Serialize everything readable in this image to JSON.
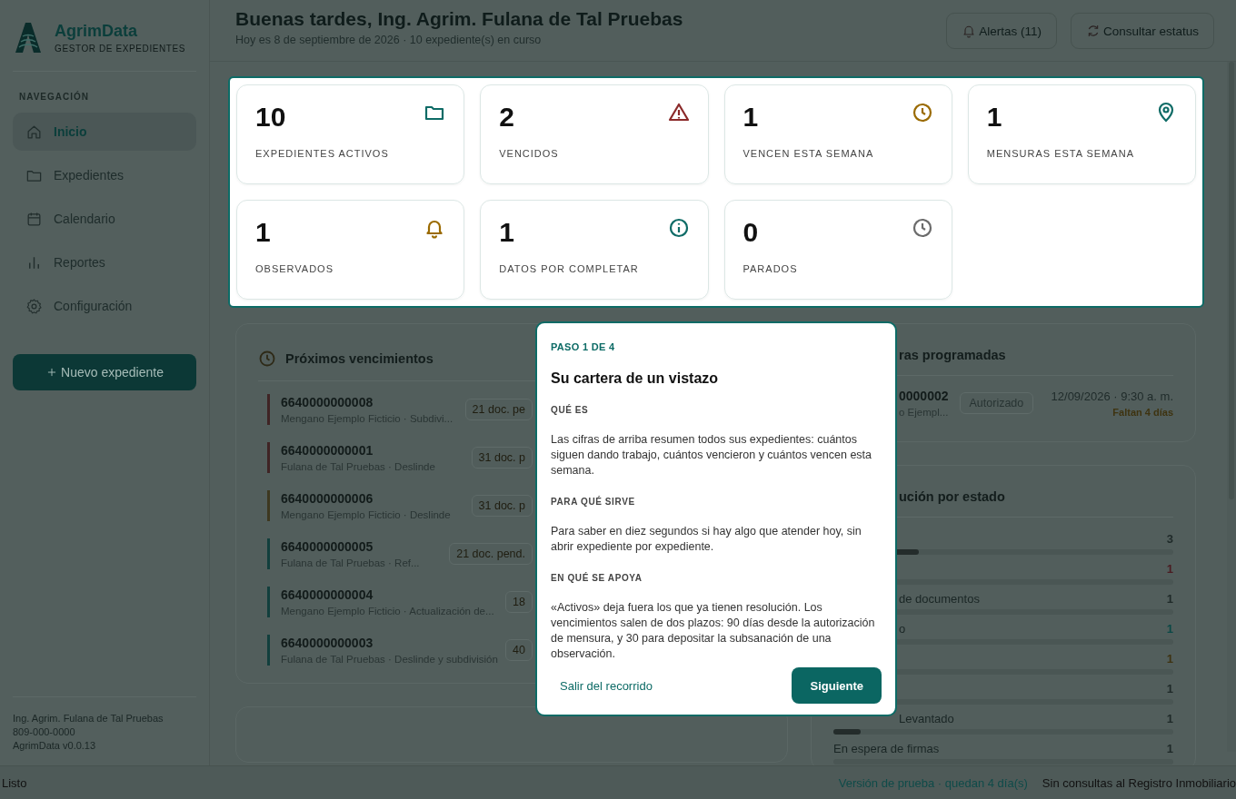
{
  "sidebar": {
    "brand": {
      "name": "AgrimData",
      "tagline": "GESTOR DE EXPEDIENTES"
    },
    "section_label": "NAVEGACIÓN",
    "items": [
      {
        "label": "Inicio",
        "kind": "home",
        "selected": true
      },
      {
        "label": "Expedientes",
        "kind": "folder",
        "selected": false
      },
      {
        "label": "Calendario",
        "kind": "calendar",
        "selected": false
      },
      {
        "label": "Reportes",
        "kind": "bars",
        "selected": false
      },
      {
        "label": "Configuración",
        "kind": "gear",
        "selected": false
      }
    ],
    "new_button": "Nuevo expediente",
    "footer": [
      "Ing. Agrim. Fulana de Tal Pruebas",
      "809-000-0000",
      "AgrimData v0.0.13"
    ]
  },
  "header": {
    "title": "Buenas tardes, Ing. Agrim. Fulana de Tal Pruebas",
    "subtitle": "Hoy es 8 de septiembre de 2026 · 10 expediente(s) en curso",
    "buttons": [
      {
        "label": "Alertas (11)",
        "kind": "bell"
      },
      {
        "label": "Consultar estatus",
        "kind": "refresh"
      }
    ]
  },
  "stats": [
    {
      "value": "10",
      "label": "EXPEDIENTES ACTIVOS",
      "kind": "folder",
      "color": "#0e6b66"
    },
    {
      "value": "2",
      "label": "VENCIDOS",
      "kind": "warning",
      "color": "#8b2a2a"
    },
    {
      "value": "1",
      "label": "VENCEN ESTA SEMANA",
      "kind": "clock",
      "color": "#9a6a00"
    },
    {
      "value": "1",
      "label": "MENSURAS ESTA SEMANA",
      "kind": "pin",
      "color": "#0e6b66"
    },
    {
      "value": "1",
      "label": "OBSERVADOS",
      "kind": "bell",
      "color": "#9a6a00"
    },
    {
      "value": "1",
      "label": "DATOS POR COMPLETAR",
      "kind": "info",
      "color": "#0e6b66"
    },
    {
      "value": "0",
      "label": "PARADOS",
      "kind": "clock",
      "color": "#6b6b6b"
    }
  ],
  "deadlines": {
    "title": "Próximos vencimientos",
    "rows": [
      {
        "id": "6640000000008",
        "detail": "Mengano Ejemplo Ficticio · Subdivi...",
        "badges": [
          "21 doc. pe"
        ],
        "color": "#3f2424"
      },
      {
        "id": "6640000000001",
        "detail": "Fulana de Tal Pruebas · Deslinde",
        "badges": [
          "31 doc. p"
        ],
        "color": "#3f2424"
      },
      {
        "id": "6640000000006",
        "detail": "Mengano Ejemplo Ficticio · Deslinde",
        "badges": [
          "31 doc. p"
        ],
        "color": "#3e3820"
      },
      {
        "id": "6640000000005",
        "detail": "Fulana de Tal Pruebas · Ref...",
        "badges": [
          "21 doc. pend."
        ],
        "color": "#123f3d"
      },
      {
        "id": "6640000000004",
        "detail": "Mengano Ejemplo Ficticio · Actualización de...",
        "badges": [
          "18"
        ],
        "color": "#123f3d"
      },
      {
        "id": "6640000000003",
        "detail": "Fulana de Tal Pruebas · Deslinde y subdivisión",
        "badges": [
          "40"
        ],
        "color": "#123f3d"
      }
    ]
  },
  "surveys": {
    "title": "ras programadas",
    "rows": [
      {
        "id": "0000002",
        "detail": "o Ejempl...",
        "badge": "Autorizado",
        "date": "12/09/2026 · 9:30 a. m.",
        "remaining": "Faltan 4 días"
      }
    ]
  },
  "distribution": {
    "title": "ución por estado",
    "rows": [
      {
        "count": "3",
        "level": 0.25,
        "color": "#1f2a29"
      },
      {
        "count": "1",
        "color": "#4a1c22"
      },
      {
        "label": "de documentos",
        "count": "1",
        "color": "#1f2a29"
      },
      {
        "label": "o",
        "count": "1",
        "color": "#0b4846"
      },
      {
        "count": "1",
        "color": "#3e3312"
      },
      {
        "count": "1",
        "color": "#1f2a29"
      },
      {
        "label": "Levantado",
        "count": "1",
        "level": 0.08,
        "color": "#1f2a29"
      },
      {
        "label": "En espera de firmas",
        "count": "1",
        "color": "#1f2a29"
      }
    ]
  },
  "tour": {
    "step": "PASO 1 DE 4",
    "title": "Su cartera de un vistazo",
    "sections": [
      {
        "heading": "QUÉ ES",
        "text": "Las cifras de arriba resumen todos sus expedientes: cuántos siguen dando trabajo, cuántos vencieron y cuántos vencen esta semana."
      },
      {
        "heading": "PARA QUÉ SIRVE",
        "text": "Para saber en diez segundos si hay algo que atender hoy, sin abrir expediente por expediente."
      },
      {
        "heading": "EN QUÉ SE APOYA",
        "text": "«Activos» deja fuera los que ya tienen resolución. Los vencimientos salen de dos plazos: 90 días desde la autorización de mensura, y 30 para depositar la subsanación de una observación."
      }
    ],
    "skip": "Salir del recorrido",
    "next": "Siguiente"
  },
  "status_bar": {
    "left": "Listo",
    "trial": "Versión de prueba · quedan 4 día(s)",
    "registry": "Sin consultas al Registro Inmobiliario"
  }
}
